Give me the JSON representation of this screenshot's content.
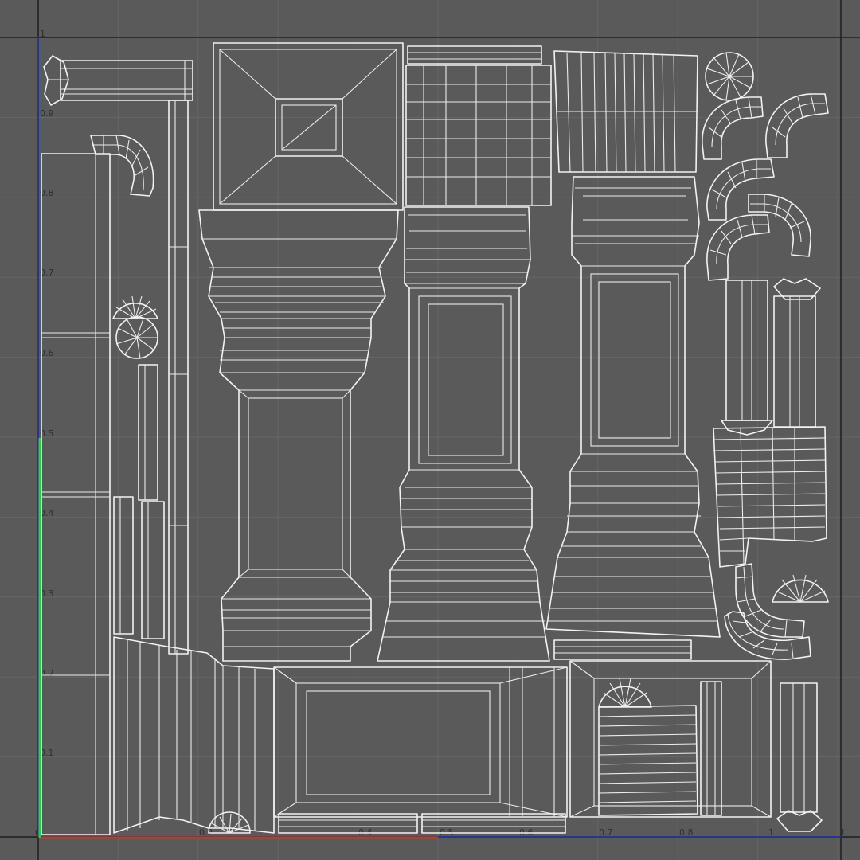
{
  "viewport": {
    "background": "#5a5a5a",
    "grid_color": "#666666",
    "frame_color": "#1e1e1e",
    "wire_color": "#f2f2f2",
    "u_axis_color": "#c0392b",
    "v_axis_color": "#2ecc40",
    "border_color": "#2233aa"
  },
  "axis_labels": {
    "v": [
      "1",
      "0.9",
      "0.8",
      "0.7",
      "0.6",
      "0.5",
      "0.4",
      "0.3",
      "0.2",
      "0.1",
      "0"
    ],
    "u": [
      "0.2",
      "0.4",
      "0.5",
      "0.6",
      "0.7",
      "0.8",
      "1",
      "1"
    ]
  },
  "uv_islands": [
    "column-top-cap-pyramid",
    "column-front-tall",
    "column-middle-tall",
    "column-right-tall",
    "base-band-long",
    "plinth-box",
    "grid-block-square",
    "strip-block-top",
    "left-tall-strip",
    "curved-arc-pieces",
    "fan-disc-pieces",
    "slim-column-pieces"
  ]
}
